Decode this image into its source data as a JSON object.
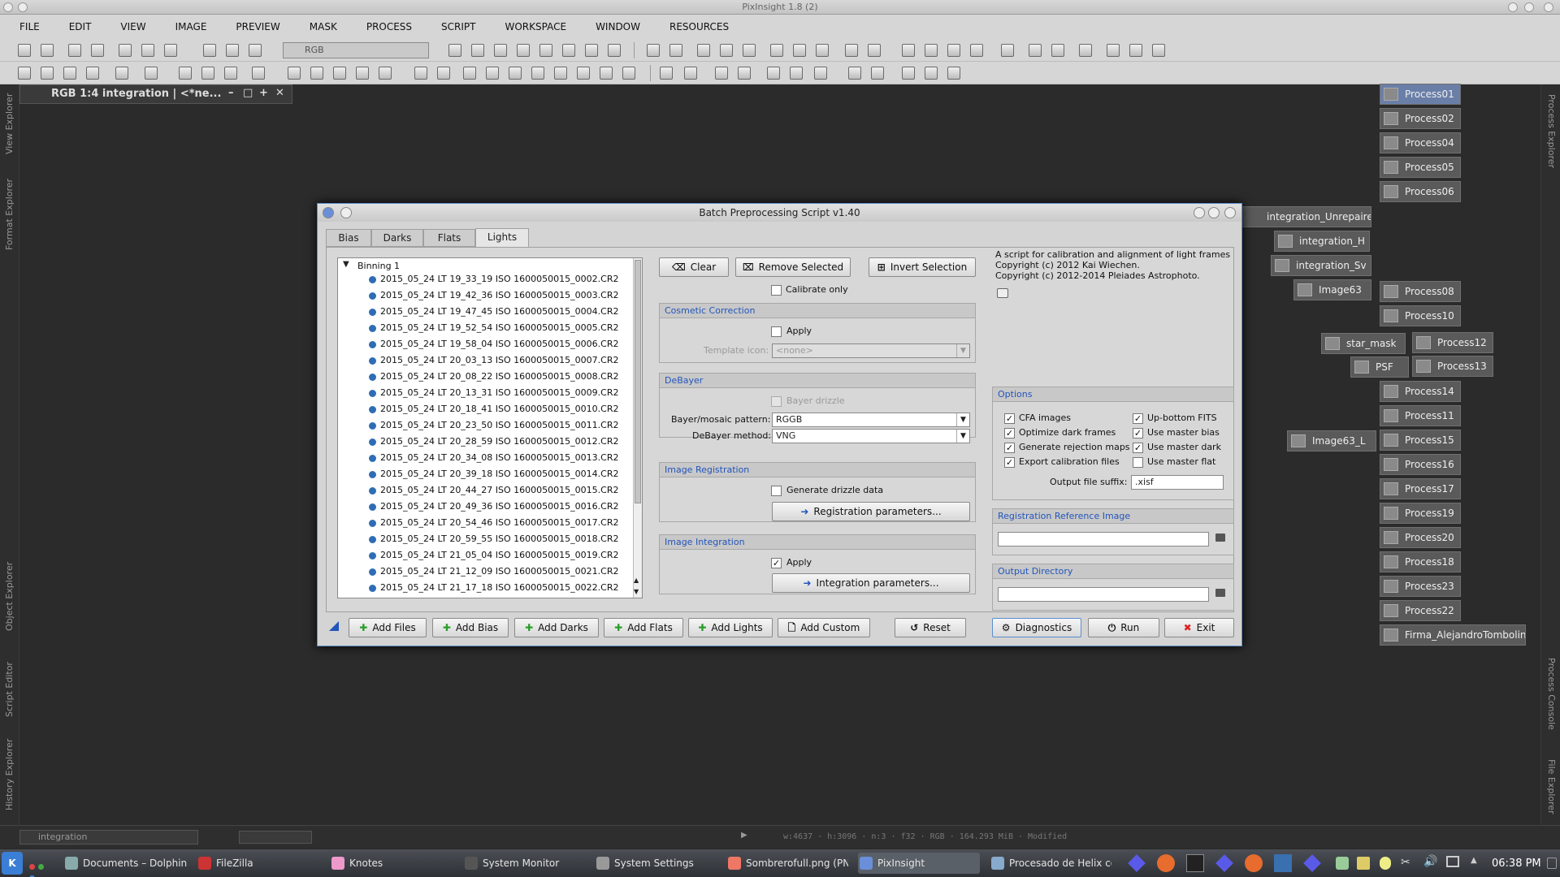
{
  "app": {
    "title": "PixInsight 1.8 (2)"
  },
  "menu": [
    "FILE",
    "EDIT",
    "VIEW",
    "IMAGE",
    "PREVIEW",
    "MASK",
    "PROCESS",
    "SCRIPT",
    "WORKSPACE",
    "WINDOW",
    "RESOURCES"
  ],
  "toolbar": {
    "color_space": "RGB"
  },
  "left_dock": [
    "View Explorer",
    "Format Explorer",
    "Object Explorer",
    "Script Editor",
    "History Explorer"
  ],
  "right_dock": [
    "Process Explorer",
    "Process Console",
    "File Explorer"
  ],
  "image_window": {
    "title": "RGB 1:4 integration | <*ne..."
  },
  "process_icons": [
    {
      "label": "Process01"
    },
    {
      "label": "Process02"
    },
    {
      "label": "Process04"
    },
    {
      "label": "Process05"
    },
    {
      "label": "Process06"
    },
    {
      "label": "Process08"
    },
    {
      "label": "Process10"
    },
    {
      "label": "Process12"
    },
    {
      "label": "Process13"
    },
    {
      "label": "Process14"
    },
    {
      "label": "Process11"
    },
    {
      "label": "Process15"
    },
    {
      "label": "Process16"
    },
    {
      "label": "Process17"
    },
    {
      "label": "Process19"
    },
    {
      "label": "Process20"
    },
    {
      "label": "Process18"
    },
    {
      "label": "Process23"
    },
    {
      "label": "Process22"
    },
    {
      "label": "Firma_AlejandroTombolini"
    }
  ],
  "image_icons": [
    {
      "label": "integration_Unrepaired_V"
    },
    {
      "label": "integration_H"
    },
    {
      "label": "integration_Sv"
    },
    {
      "label": "Image63"
    },
    {
      "label": "star_mask"
    },
    {
      "label": "PSF"
    },
    {
      "label": "Image63_L"
    }
  ],
  "dialog": {
    "title": "Batch Preprocessing Script v1.40",
    "tabs": [
      "Bias",
      "Darks",
      "Flats",
      "Lights"
    ],
    "tree_root": "Binning 1",
    "files": [
      "2015_05_24 LT 19_33_19 ISO 1600050015_0002.CR2",
      "2015_05_24 LT 19_42_36 ISO 1600050015_0003.CR2",
      "2015_05_24 LT 19_47_45 ISO 1600050015_0004.CR2",
      "2015_05_24 LT 19_52_54 ISO 1600050015_0005.CR2",
      "2015_05_24 LT 19_58_04 ISO 1600050015_0006.CR2",
      "2015_05_24 LT 20_03_13 ISO 1600050015_0007.CR2",
      "2015_05_24 LT 20_08_22 ISO 1600050015_0008.CR2",
      "2015_05_24 LT 20_13_31 ISO 1600050015_0009.CR2",
      "2015_05_24 LT 20_18_41 ISO 1600050015_0010.CR2",
      "2015_05_24 LT 20_23_50 ISO 1600050015_0011.CR2",
      "2015_05_24 LT 20_28_59 ISO 1600050015_0012.CR2",
      "2015_05_24 LT 20_34_08 ISO 1600050015_0013.CR2",
      "2015_05_24 LT 20_39_18 ISO 1600050015_0014.CR2",
      "2015_05_24 LT 20_44_27 ISO 1600050015_0015.CR2",
      "2015_05_24 LT 20_49_36 ISO 1600050015_0016.CR2",
      "2015_05_24 LT 20_54_46 ISO 1600050015_0017.CR2",
      "2015_05_24 LT 20_59_55 ISO 1600050015_0018.CR2",
      "2015_05_24 LT 21_05_04 ISO 1600050015_0019.CR2",
      "2015_05_24 LT 21_12_09 ISO 1600050015_0021.CR2",
      "2015_05_24 LT 21_17_18 ISO 1600050015_0022.CR2"
    ],
    "buttons_top": {
      "clear": "Clear",
      "remove_selected": "Remove Selected",
      "invert_selection": "Invert Selection"
    },
    "calibrate_only": "Calibrate only",
    "cosmetic": {
      "title": "Cosmetic Correction",
      "apply": "Apply",
      "template_label": "Template icon:",
      "template_value": "<none>"
    },
    "debayer": {
      "title": "DeBayer",
      "drizzle": "Bayer drizzle",
      "pattern_label": "Bayer/mosaic pattern:",
      "pattern_value": "RGGB",
      "method_label": "DeBayer method:",
      "method_value": "VNG"
    },
    "registration": {
      "title": "Image Registration",
      "drizzle": "Generate drizzle data",
      "params": "Registration parameters..."
    },
    "integration": {
      "title": "Image Integration",
      "apply": "Apply",
      "params": "Integration parameters..."
    },
    "info": {
      "line1": "A script for calibration and alignment of light frames",
      "line2": "Copyright (c) 2012 Kai Wiechen.",
      "line3": "Copyright (c) 2012-2014 Pleiades Astrophoto."
    },
    "options": {
      "title": "Options",
      "cfa": "CFA images",
      "upbottom": "Up-bottom FITS",
      "optimize": "Optimize dark frames",
      "master_bias": "Use master bias",
      "rejection": "Generate rejection maps",
      "master_dark": "Use master dark",
      "export": "Export calibration files",
      "master_flat": "Use master flat",
      "suffix_label": "Output file suffix:",
      "suffix_value": ".xisf"
    },
    "ref_image": {
      "title": "Registration Reference Image",
      "value": ""
    },
    "output_dir": {
      "title": "Output Directory",
      "value": ""
    },
    "buttons_bottom": {
      "add_files": "Add Files",
      "add_bias": "Add Bias",
      "add_darks": "Add Darks",
      "add_flats": "Add Flats",
      "add_lights": "Add Lights",
      "add_custom": "Add Custom",
      "reset": "Reset",
      "diagnostics": "Diagnostics",
      "run": "Run",
      "exit": "Exit"
    }
  },
  "statusbar": {
    "view": "integration",
    "info": "w:4637  ·  h:3096  ·  n:3  ·  f32  ·  RGB  ·  164.293 MiB  ·  Modified"
  },
  "taskbar": {
    "tasks": [
      "Documents – Dolphin",
      "FileZilla",
      "Knotes",
      "System Monitor",
      "System Settings",
      "Sombrerofull.png (PN...",
      "PixInsight",
      "Procesado de Helix con..."
    ],
    "clock": "06:38 PM"
  }
}
